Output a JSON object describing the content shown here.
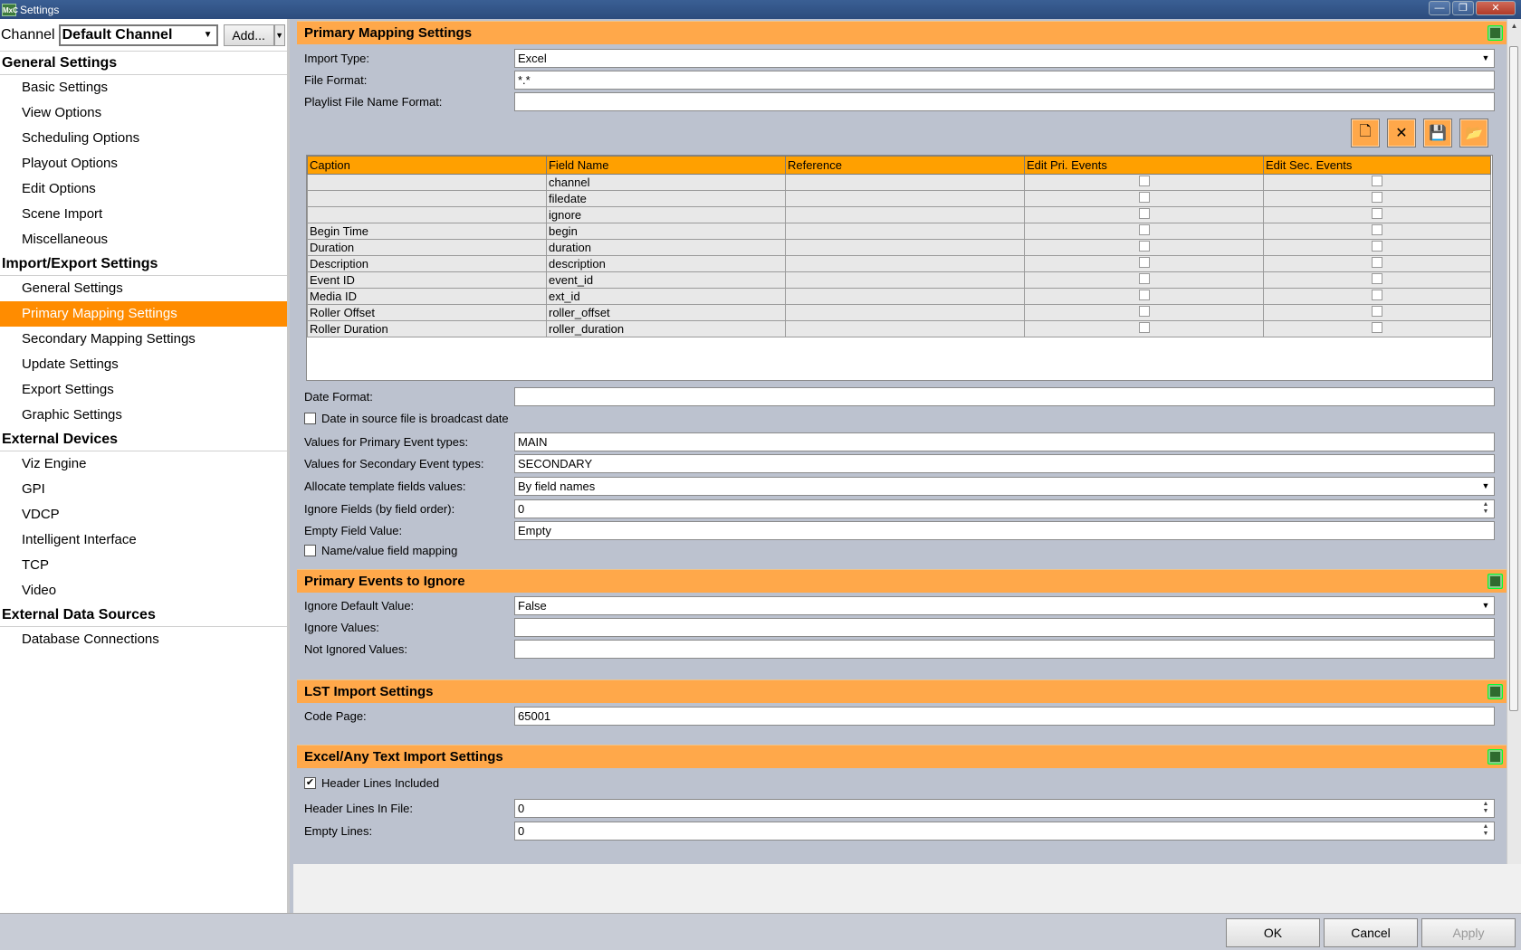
{
  "window": {
    "app_icon_text": "MxC",
    "title": "Settings"
  },
  "sidebar": {
    "channel_label": "Channel",
    "channel_value": "Default Channel",
    "add_label": "Add...",
    "groups": [
      {
        "title": "General Settings",
        "items": [
          "Basic Settings",
          "View Options",
          "Scheduling Options",
          "Playout Options",
          "Edit Options",
          "Scene Import",
          "Miscellaneous"
        ]
      },
      {
        "title": "Import/Export Settings",
        "items": [
          "General Settings",
          "Primary Mapping Settings",
          "Secondary Mapping Settings",
          "Update Settings",
          "Export Settings",
          "Graphic Settings"
        ]
      },
      {
        "title": "External Devices",
        "items": [
          "Viz Engine",
          "GPI",
          "VDCP",
          "Intelligent Interface",
          "TCP",
          "Video"
        ]
      },
      {
        "title": "External Data Sources",
        "items": [
          "Database Connections"
        ]
      }
    ],
    "active_item": "Primary Mapping Settings"
  },
  "primary": {
    "title": "Primary Mapping Settings",
    "import_type_label": "Import Type:",
    "import_type_value": "Excel",
    "file_format_label": "File Format:",
    "file_format_value": "*.*",
    "playlist_label": "Playlist File Name Format:",
    "playlist_value": "",
    "grid": {
      "columns": [
        "Caption",
        "Field Name",
        "Reference",
        "Edit Pri. Events",
        "Edit Sec. Events"
      ],
      "rows": [
        {
          "caption": "",
          "field": "channel",
          "reference": "",
          "pri": false,
          "sec": false
        },
        {
          "caption": "",
          "field": "filedate",
          "reference": "",
          "pri": false,
          "sec": false
        },
        {
          "caption": "",
          "field": "ignore",
          "reference": "",
          "pri": false,
          "sec": false
        },
        {
          "caption": "Begin Time",
          "field": "begin",
          "reference": "",
          "pri": false,
          "sec": false
        },
        {
          "caption": "Duration",
          "field": "duration",
          "reference": "",
          "pri": false,
          "sec": false
        },
        {
          "caption": "Description",
          "field": "description",
          "reference": "",
          "pri": false,
          "sec": false
        },
        {
          "caption": "Event ID",
          "field": "event_id",
          "reference": "",
          "pri": false,
          "sec": false
        },
        {
          "caption": "Media ID",
          "field": "ext_id",
          "reference": "",
          "pri": false,
          "sec": false
        },
        {
          "caption": "Roller Offset",
          "field": "roller_offset",
          "reference": "",
          "pri": false,
          "sec": false
        },
        {
          "caption": "Roller Duration",
          "field": "roller_duration",
          "reference": "",
          "pri": false,
          "sec": false
        }
      ]
    },
    "date_format_label": "Date Format:",
    "date_format_value": "",
    "broadcast_date_label": "Date in source file is broadcast date",
    "primary_types_label": "Values for Primary Event types:",
    "primary_types_value": "MAIN",
    "secondary_types_label": "Values for Secondary Event types:",
    "secondary_types_value": "SECONDARY",
    "allocate_label": "Allocate template fields values:",
    "allocate_value": "By field names",
    "ignore_fields_label": "Ignore Fields (by field order):",
    "ignore_fields_value": "0",
    "empty_field_label": "Empty Field Value:",
    "empty_field_value": "Empty",
    "namevalue_label": "Name/value field mapping"
  },
  "ignore_section": {
    "title": "Primary Events to Ignore",
    "default_label": "Ignore Default Value:",
    "default_value": "False",
    "values_label": "Ignore Values:",
    "values_value": "",
    "not_ignored_label": "Not Ignored Values:",
    "not_ignored_value": ""
  },
  "lst_section": {
    "title": "LST Import Settings",
    "code_page_label": "Code Page:",
    "code_page_value": "65001"
  },
  "excel_section": {
    "title": "Excel/Any Text Import Settings",
    "header_included_label": "Header Lines Included",
    "header_lines_label": "Header Lines In File:",
    "header_lines_value": "0",
    "empty_lines_label": "Empty Lines:",
    "empty_lines_value": "0"
  },
  "buttons": {
    "ok": "OK",
    "cancel": "Cancel",
    "apply": "Apply"
  },
  "colors": {
    "accent": "#ff8c00",
    "section_header": "#ffa84a",
    "grid_header": "#ffa000"
  }
}
